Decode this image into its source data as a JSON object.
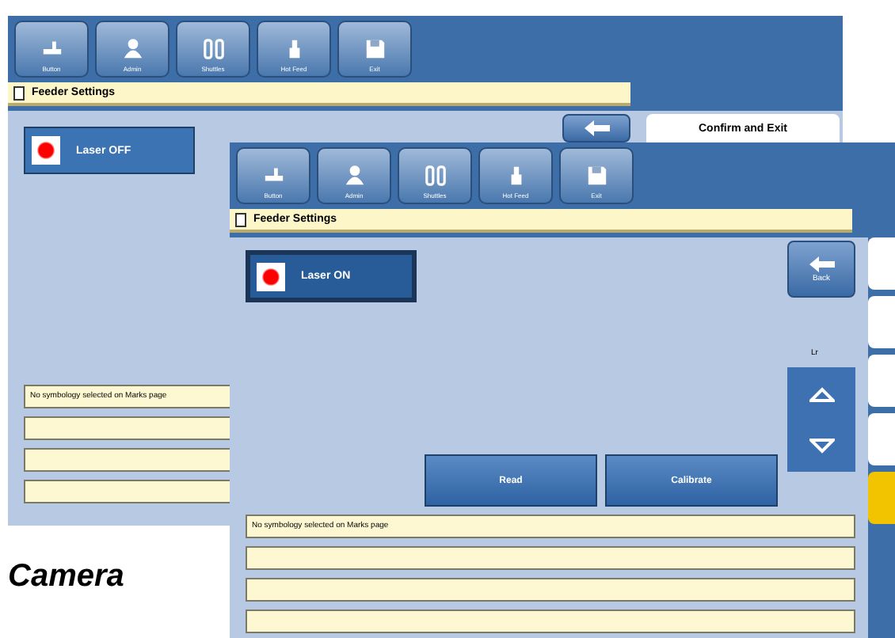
{
  "windows": [
    {
      "toolbar": [
        "Button",
        "Admin",
        "Shuttles",
        "Hot Feed",
        "Exit"
      ],
      "title": "Feeder Settings",
      "laser": {
        "label": "Laser OFF",
        "selected": false
      },
      "side_card": "Confirm and Exit",
      "message": "No symbology selected on Marks page"
    },
    {
      "toolbar": [
        "Button",
        "Admin",
        "Shuttles",
        "Hot Feed",
        "Exit"
      ],
      "title": "Feeder Settings",
      "laser": {
        "label": "Laser ON",
        "selected": true
      },
      "back_label": "Back",
      "stepper_label": "Lr",
      "actions": [
        "Read",
        "Calibrate"
      ],
      "side_tabs": [
        {
          "selected": false
        },
        {
          "selected": false
        },
        {
          "selected": false
        },
        {
          "selected": false
        },
        {
          "selected": true
        }
      ],
      "message": "No symbology selected on Marks page"
    }
  ],
  "caption": "Camera"
}
